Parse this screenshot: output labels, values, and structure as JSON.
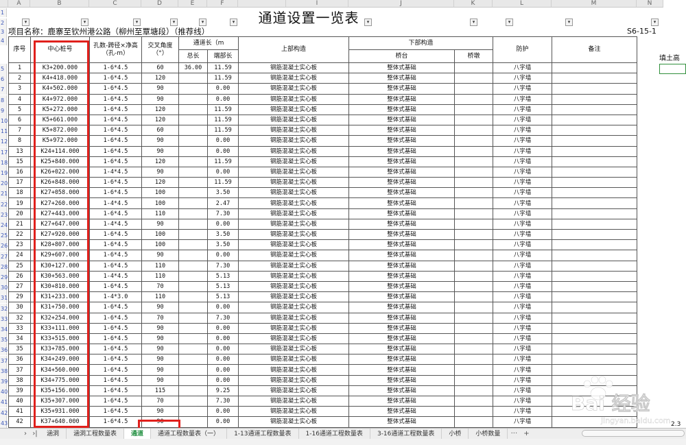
{
  "columns": [
    "A",
    "B",
    "C",
    "D",
    "E",
    "F",
    "",
    "I",
    "",
    "J",
    "K",
    "L",
    "M",
    "N"
  ],
  "title": "通道设置一览表",
  "project_label": "项目名称：鹿寨至钦州港公路（柳州至覃塘段）（推荐线）",
  "sheet_code": "S6-15-1",
  "headers": {
    "seq": "序号",
    "station": "中心桩号",
    "span": "孔数-跨径×净高（孔-m）",
    "angle": "交叉角度（°）",
    "length": "通道长（m",
    "total": "总长",
    "end": "端部长",
    "upper": "上部构造",
    "lower": "下部构造",
    "abutment": "桥台",
    "pier": "桥墩",
    "protect": "防护",
    "remark": "备注",
    "fill": "填土高"
  },
  "row_numbers": [
    "5",
    "6",
    "7",
    "8",
    "9",
    "10",
    "11",
    "12",
    "17",
    "18",
    "19",
    "20",
    "21",
    "22",
    "23",
    "24",
    "25",
    "26",
    "27",
    "28",
    "29",
    "30",
    "31",
    "32",
    "33",
    "34",
    "35",
    "36",
    "37",
    "38",
    "39",
    "40",
    "41",
    "42",
    "43",
    "44",
    "45",
    "46",
    "47"
  ],
  "rows": [
    {
      "no": "1",
      "station": "K3+200.000",
      "span": "1-6*4.5",
      "angle": "60",
      "total": "36.00",
      "end": "11.59",
      "upper": "钢筋混凝土实心板",
      "abut": "整体式基础",
      "prot": "八字墙"
    },
    {
      "no": "2",
      "station": "K4+418.000",
      "span": "1-6*4.5",
      "angle": "120",
      "total": "",
      "end": "11.59",
      "upper": "钢筋混凝土实心板",
      "abut": "整体式基础",
      "prot": "八字墙"
    },
    {
      "no": "3",
      "station": "K4+502.000",
      "span": "1-6*4.5",
      "angle": "90",
      "total": "",
      "end": "0.00",
      "upper": "钢筋混凝土实心板",
      "abut": "整体式基础",
      "prot": "八字墙"
    },
    {
      "no": "4",
      "station": "K4+972.000",
      "span": "1-6*4.5",
      "angle": "90",
      "total": "",
      "end": "0.00",
      "upper": "钢筋混凝土实心板",
      "abut": "整体式基础",
      "prot": "八字墙"
    },
    {
      "no": "5",
      "station": "K5+272.000",
      "span": "1-6*4.5",
      "angle": "120",
      "total": "",
      "end": "11.59",
      "upper": "钢筋混凝土实心板",
      "abut": "整体式基础",
      "prot": "八字墙"
    },
    {
      "no": "6",
      "station": "K5+661.000",
      "span": "1-6*4.5",
      "angle": "120",
      "total": "",
      "end": "11.59",
      "upper": "钢筋混凝土实心板",
      "abut": "整体式基础",
      "prot": "八字墙"
    },
    {
      "no": "7",
      "station": "K5+872.000",
      "span": "1-6*4.5",
      "angle": "60",
      "total": "",
      "end": "11.59",
      "upper": "钢筋混凝土实心板",
      "abut": "整体式基础",
      "prot": "八字墙"
    },
    {
      "no": "8",
      "station": "K5+972.000",
      "span": "1-6*4.5",
      "angle": "90",
      "total": "",
      "end": "0.00",
      "upper": "钢筋混凝土实心板",
      "abut": "整体式基础",
      "prot": "八字墙"
    },
    {
      "no": "13",
      "station": "K24+114.000",
      "span": "1-6*4.5",
      "angle": "90",
      "total": "",
      "end": "0.00",
      "upper": "钢筋混凝土实心板",
      "abut": "整体式基础",
      "prot": "八字墙"
    },
    {
      "no": "15",
      "station": "K25+840.000",
      "span": "1-6*4.5",
      "angle": "120",
      "total": "",
      "end": "11.59",
      "upper": "钢筋混凝土实心板",
      "abut": "整体式基础",
      "prot": "八字墙"
    },
    {
      "no": "16",
      "station": "K26+022.000",
      "span": "1-4*4.5",
      "angle": "90",
      "total": "",
      "end": "0.00",
      "upper": "钢筋混凝土实心板",
      "abut": "整体式基础",
      "prot": "八字墙"
    },
    {
      "no": "17",
      "station": "K26+848.000",
      "span": "1-6*4.5",
      "angle": "120",
      "total": "",
      "end": "11.59",
      "upper": "钢筋混凝土实心板",
      "abut": "整体式基础",
      "prot": "八字墙"
    },
    {
      "no": "18",
      "station": "K27+058.000",
      "span": "1-6*4.5",
      "angle": "100",
      "total": "",
      "end": "3.50",
      "upper": "钢筋混凝土实心板",
      "abut": "整体式基础",
      "prot": "八字墙"
    },
    {
      "no": "19",
      "station": "K27+260.000",
      "span": "1-4*4.5",
      "angle": "100",
      "total": "",
      "end": "2.47",
      "upper": "钢筋混凝土实心板",
      "abut": "整体式基础",
      "prot": "八字墙"
    },
    {
      "no": "20",
      "station": "K27+443.000",
      "span": "1-6*4.5",
      "angle": "110",
      "total": "",
      "end": "7.30",
      "upper": "钢筋混凝土实心板",
      "abut": "整体式基础",
      "prot": "八字墙"
    },
    {
      "no": "21",
      "station": "K27+647.000",
      "span": "1-4*4.5",
      "angle": "90",
      "total": "",
      "end": "0.00",
      "upper": "钢筋混凝土实心板",
      "abut": "整体式基础",
      "prot": "八字墙"
    },
    {
      "no": "22",
      "station": "K27+920.000",
      "span": "1-6*4.5",
      "angle": "100",
      "total": "",
      "end": "3.50",
      "upper": "钢筋混凝土实心板",
      "abut": "整体式基础",
      "prot": "八字墙"
    },
    {
      "no": "23",
      "station": "K28+807.000",
      "span": "1-6*4.5",
      "angle": "100",
      "total": "",
      "end": "3.50",
      "upper": "钢筋混凝土实心板",
      "abut": "整体式基础",
      "prot": "八字墙"
    },
    {
      "no": "24",
      "station": "K29+607.000",
      "span": "1-6*4.5",
      "angle": "90",
      "total": "",
      "end": "0.00",
      "upper": "钢筋混凝土实心板",
      "abut": "整体式基础",
      "prot": "八字墙"
    },
    {
      "no": "25",
      "station": "K30+127.000",
      "span": "1-6*4.5",
      "angle": "110",
      "total": "",
      "end": "7.30",
      "upper": "钢筋混凝土实心板",
      "abut": "整体式基础",
      "prot": "八字墙"
    },
    {
      "no": "26",
      "station": "K30+563.000",
      "span": "1-4*4.5",
      "angle": "110",
      "total": "",
      "end": "5.13",
      "upper": "钢筋混凝土实心板",
      "abut": "整体式基础",
      "prot": "八字墙"
    },
    {
      "no": "27",
      "station": "K30+810.000",
      "span": "1-6*4.5",
      "angle": "70",
      "total": "",
      "end": "5.13",
      "upper": "钢筋混凝土实心板",
      "abut": "整体式基础",
      "prot": "八字墙"
    },
    {
      "no": "29",
      "station": "K31+233.000",
      "span": "1-4*3.0",
      "angle": "110",
      "total": "",
      "end": "5.13",
      "upper": "钢筋混凝土实心板",
      "abut": "整体式基础",
      "prot": "八字墙"
    },
    {
      "no": "30",
      "station": "K31+750.000",
      "span": "1-6*4.5",
      "angle": "90",
      "total": "",
      "end": "0.00",
      "upper": "钢筋混凝土实心板",
      "abut": "整体式基础",
      "prot": "八字墙"
    },
    {
      "no": "32",
      "station": "K32+254.000",
      "span": "1-6*4.5",
      "angle": "70",
      "total": "",
      "end": "7.30",
      "upper": "钢筋混凝土实心板",
      "abut": "整体式基础",
      "prot": "八字墙"
    },
    {
      "no": "33",
      "station": "K33+111.000",
      "span": "1-6*4.5",
      "angle": "90",
      "total": "",
      "end": "0.00",
      "upper": "钢筋混凝土实心板",
      "abut": "整体式基础",
      "prot": "八字墙"
    },
    {
      "no": "34",
      "station": "K33+515.000",
      "span": "1-6*4.5",
      "angle": "90",
      "total": "",
      "end": "0.00",
      "upper": "钢筋混凝土实心板",
      "abut": "整体式基础",
      "prot": "八字墙"
    },
    {
      "no": "35",
      "station": "K33+785.000",
      "span": "1-6*4.5",
      "angle": "90",
      "total": "",
      "end": "0.00",
      "upper": "钢筋混凝土实心板",
      "abut": "整体式基础",
      "prot": "八字墙"
    },
    {
      "no": "36",
      "station": "K34+249.000",
      "span": "1-6*4.5",
      "angle": "90",
      "total": "",
      "end": "0.00",
      "upper": "钢筋混凝土实心板",
      "abut": "整体式基础",
      "prot": "八字墙"
    },
    {
      "no": "37",
      "station": "K34+560.000",
      "span": "1-6*4.5",
      "angle": "90",
      "total": "",
      "end": "0.00",
      "upper": "钢筋混凝土实心板",
      "abut": "整体式基础",
      "prot": "八字墙"
    },
    {
      "no": "38",
      "station": "K34+775.000",
      "span": "1-6*4.5",
      "angle": "90",
      "total": "",
      "end": "0.00",
      "upper": "钢筋混凝土实心板",
      "abut": "整体式基础",
      "prot": "八字墙"
    },
    {
      "no": "39",
      "station": "K35+156.000",
      "span": "1-6*4.5",
      "angle": "115",
      "total": "",
      "end": "9.25",
      "upper": "钢筋混凝土实心板",
      "abut": "整体式基础",
      "prot": "八字墙"
    },
    {
      "no": "40",
      "station": "K35+307.000",
      "span": "1-6*4.5",
      "angle": "70",
      "total": "",
      "end": "7.30",
      "upper": "钢筋混凝土实心板",
      "abut": "整体式基础",
      "prot": "八字墙"
    },
    {
      "no": "41",
      "station": "K35+931.000",
      "span": "1-6*4.5",
      "angle": "90",
      "total": "",
      "end": "0.00",
      "upper": "钢筋混凝土实心板",
      "abut": "整体式基础",
      "prot": "八字墙"
    },
    {
      "no": "42",
      "station": "K37+640.000",
      "span": "1-6*4.5",
      "angle": "90",
      "total": "",
      "end": "0.00",
      "upper": "钢筋混凝土实心板",
      "abut": "整体式基础",
      "prot": "八字墙"
    }
  ],
  "extra_value": "2.3",
  "tabs": [
    "涵洞",
    "涵洞工程数量表",
    "通道",
    "通道工程数量表（一）",
    "1-13通道工程数量表",
    "1-16通道工程数量表",
    "3-16通道工程数量表",
    "小桥",
    "小桥数量"
  ],
  "active_tab": "通道",
  "tab_more": "···",
  "tab_add": "+",
  "watermark": "Bai 经验",
  "watermark_url": "jingyan.baidu.com",
  "colors": {
    "highlight": "#e0201c",
    "active_tab": "#1e8e3e",
    "grid": "#555555"
  }
}
